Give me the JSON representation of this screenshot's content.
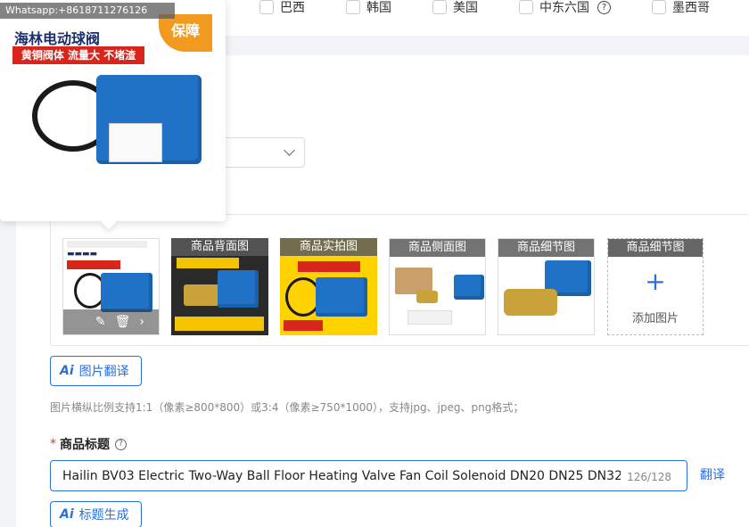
{
  "countries": [
    {
      "label": "巴西",
      "checked": false
    },
    {
      "label": "韩国",
      "checked": false
    },
    {
      "label": "美国",
      "checked": false
    },
    {
      "label": "中东六国",
      "checked": false,
      "has_help": true
    },
    {
      "label": "墨西哥",
      "checked": false
    }
  ],
  "popover": {
    "watermark": "Whatsapp:+8618711276126",
    "product_brand": "海林电动球阀",
    "product_tagline": "黄铜阀体 流量大 不堵渣",
    "badge": "保障"
  },
  "images": [
    {
      "label": "",
      "icon": "main-product-photo",
      "toolbar": {
        "edit": "edit-icon",
        "delete": "delete-icon",
        "next": "chevron-right-icon"
      }
    },
    {
      "label": "商品背面图",
      "icon": "product-back-photo"
    },
    {
      "label": "商品实拍图",
      "icon": "product-real-photo"
    },
    {
      "label": "商品侧面图",
      "icon": "product-side-photo"
    },
    {
      "label": "商品细节图",
      "icon": "product-detail-photo"
    }
  ],
  "add_image": {
    "label": "商品细节图",
    "text": "添加图片"
  },
  "image_translate_button": "图片翻译",
  "image_hint": "图片横纵比例支持1:1（像素≥800*800）或3:4（像素≥750*1000），支持jpg、jpeg、png格式；",
  "title_field": {
    "label": "商品标题",
    "value": "Hailin BV03 Electric Two-Way Ball Floor Heating Valve Fan Coil Solenoid DN20 DN25 DN32 -",
    "count": "126/128",
    "translate": "翻译"
  },
  "title_generate_button": "标题生成",
  "colors": {
    "accent": "#2a6fdb",
    "required": "#e0382b"
  }
}
